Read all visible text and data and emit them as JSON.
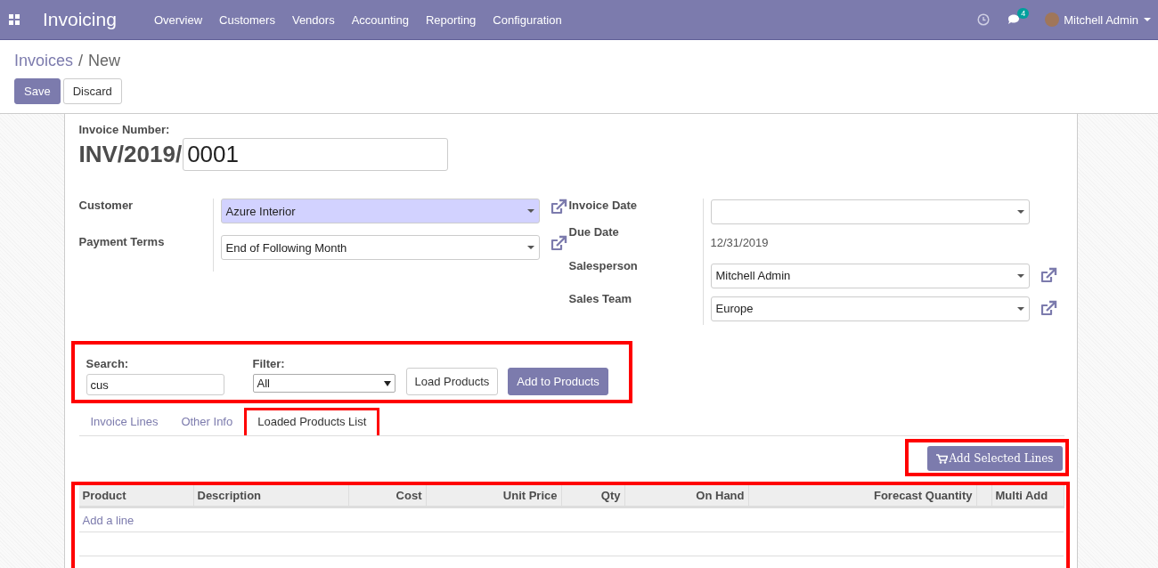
{
  "navbar": {
    "app_name": "Invoicing",
    "menu": [
      "Overview",
      "Customers",
      "Vendors",
      "Accounting",
      "Reporting",
      "Configuration"
    ],
    "messages_count": "4",
    "user": "Mitchell Admin"
  },
  "breadcrumb": {
    "parent": "Invoices",
    "separator": "/",
    "current": "New"
  },
  "actions": [
    "Save",
    "Discard"
  ],
  "invoice_number": {
    "label": "Invoice Number:",
    "prefix": "INV/2019/",
    "value": "0001"
  },
  "left_fields": [
    {
      "label": "Customer",
      "kind": "select",
      "value": "Azure Interior",
      "required": true,
      "external_link": true
    },
    {
      "label": "Payment Terms",
      "kind": "select",
      "value": "End of Following Month",
      "required": false,
      "external_link": true
    }
  ],
  "right_fields": [
    {
      "label": "Invoice Date",
      "kind": "select",
      "external_link": false
    },
    {
      "label": "Due Date",
      "kind": "text",
      "value": "12/31/2019",
      "external_link": false
    },
    {
      "label": "Salesperson",
      "kind": "select",
      "value": "Mitchell Admin",
      "external_link": true
    },
    {
      "label": "Sales Team",
      "kind": "select",
      "value": "Europe",
      "external_link": true
    }
  ],
  "product_search": {
    "search_label": "Search:",
    "search_value": "cus",
    "filter_label": "Filter:",
    "filter_value": "All",
    "load_button": "Load Products",
    "add_button": "Add to Products"
  },
  "tabs": [
    {
      "label": "Invoice Lines",
      "selected": false
    },
    {
      "label": "Other Info",
      "selected": false
    },
    {
      "label": "Loaded Products List",
      "selected": true
    }
  ],
  "add_selected_button": "Add Selected Lines",
  "table": {
    "columns": [
      "Product",
      "Description",
      "Cost",
      "Unit Price",
      "Qty",
      "On Hand",
      "Forecast Quantity",
      "Multi Add"
    ],
    "add_line": "Add a line"
  }
}
